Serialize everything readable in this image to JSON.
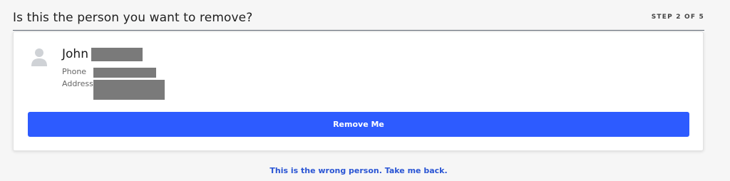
{
  "header": {
    "title": "Is this the person you want to remove?",
    "step": "STEP 2 OF 5"
  },
  "person": {
    "first_name": "John",
    "fields": {
      "phone_label": "Phone",
      "address_label": "Address"
    },
    "avatar_icon": "user-silhouette-icon"
  },
  "actions": {
    "remove_label": "Remove Me",
    "back_label": "This is the wrong person. Take me back."
  },
  "colors": {
    "accent": "#2d5bff",
    "link": "#2a55d4",
    "redaction": "#7a7a7a",
    "background": "#f6f6f6"
  }
}
